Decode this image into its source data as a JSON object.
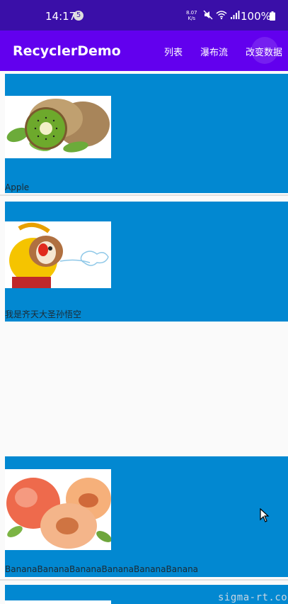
{
  "status_bar": {
    "time": "14:17",
    "notification_count": "5",
    "net_speed_value": "8.07",
    "net_speed_unit": "K/s",
    "battery": "100%"
  },
  "app_bar": {
    "title": "RecyclerDemo",
    "menu": [
      "列表",
      "瀑布流",
      "改变数据"
    ]
  },
  "items": [
    {
      "label": "Apple",
      "image": "kiwi-image"
    },
    {
      "label": "我是齐天大圣孙悟空",
      "image": "monkey-king-image"
    },
    {
      "label": "BananaBananaBananaBananaBananaBanana",
      "image": "peach-image"
    }
  ],
  "watermark": "sigma-rt.co",
  "colors": {
    "status_bar": "#3a0fa8",
    "app_bar": "#6200ee",
    "item_background": "#0288d1",
    "page_background": "#fafafa"
  }
}
